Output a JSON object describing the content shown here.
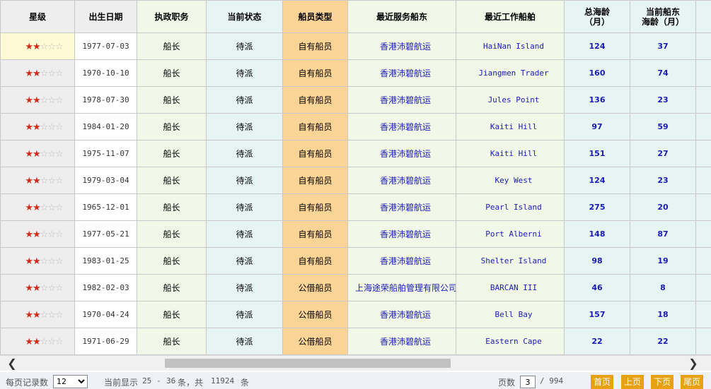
{
  "columns": {
    "star": "星级",
    "birth": "出生日期",
    "duty": "执政职务",
    "state": "当前状态",
    "type": "船员类型",
    "owner": "最近服务船东",
    "ship": "最近工作船舶",
    "total_l1": "总海龄",
    "total_l2": "（月）",
    "cur_l1": "当前船东",
    "cur_l2": "海龄（月）",
    "extra": "当"
  },
  "stars": {
    "filled": "★★",
    "empty": "☆☆☆",
    "count": 2,
    "max": 5
  },
  "rows": [
    {
      "birth": "1977-07-03",
      "duty": "船长",
      "state": "待派",
      "type": "自有船员",
      "owner": "香港沛碧航运",
      "ship": "HaiNan Island",
      "total": "124",
      "current": "37"
    },
    {
      "birth": "1970-10-10",
      "duty": "船长",
      "state": "待派",
      "type": "自有船员",
      "owner": "香港沛碧航运",
      "ship": "Jiangmen Trader",
      "total": "160",
      "current": "74"
    },
    {
      "birth": "1978-07-30",
      "duty": "船长",
      "state": "待派",
      "type": "自有船员",
      "owner": "香港沛碧航运",
      "ship": "Jules Point",
      "total": "136",
      "current": "23"
    },
    {
      "birth": "1984-01-20",
      "duty": "船长",
      "state": "待派",
      "type": "自有船员",
      "owner": "香港沛碧航运",
      "ship": "Kaiti Hill",
      "total": "97",
      "current": "59"
    },
    {
      "birth": "1975-11-07",
      "duty": "船长",
      "state": "待派",
      "type": "自有船员",
      "owner": "香港沛碧航运",
      "ship": "Kaiti Hill",
      "total": "151",
      "current": "27"
    },
    {
      "birth": "1979-03-04",
      "duty": "船长",
      "state": "待派",
      "type": "自有船员",
      "owner": "香港沛碧航运",
      "ship": "Key West",
      "total": "124",
      "current": "23"
    },
    {
      "birth": "1965-12-01",
      "duty": "船长",
      "state": "待派",
      "type": "自有船员",
      "owner": "香港沛碧航运",
      "ship": "Pearl Island",
      "total": "275",
      "current": "20"
    },
    {
      "birth": "1977-05-21",
      "duty": "船长",
      "state": "待派",
      "type": "自有船员",
      "owner": "香港沛碧航运",
      "ship": "Port Alberni",
      "total": "148",
      "current": "87"
    },
    {
      "birth": "1983-01-25",
      "duty": "船长",
      "state": "待派",
      "type": "自有船员",
      "owner": "香港沛碧航运",
      "ship": "Shelter Island",
      "total": "98",
      "current": "19"
    },
    {
      "birth": "1982-02-03",
      "duty": "船长",
      "state": "待派",
      "type": "公借船员",
      "owner": "上海途荣船舶管理有限公司",
      "ship": "BARCAN III",
      "total": "46",
      "current": "8"
    },
    {
      "birth": "1970-04-24",
      "duty": "船长",
      "state": "待派",
      "type": "公借船员",
      "owner": "香港沛碧航运",
      "ship": "Bell Bay",
      "total": "157",
      "current": "18"
    },
    {
      "birth": "1971-06-29",
      "duty": "船长",
      "state": "待派",
      "type": "公借船员",
      "owner": "香港沛碧航运",
      "ship": "Eastern Cape",
      "total": "22",
      "current": "22"
    }
  ],
  "scrollbar": {
    "left_arrow": "❮",
    "right_arrow": "❯"
  },
  "pager": {
    "per_page_label": "每页记录数",
    "per_page_value": "12",
    "showing_label": "当前显示",
    "range_from": "25",
    "range_sep": "-",
    "range_to": "36",
    "total_prefix": "条，共",
    "total": "11924",
    "total_suffix": "条",
    "page_label": "页数",
    "page_value": "3",
    "page_total": "/ 994",
    "first": "首页",
    "prev": "上页",
    "next": "下页",
    "last": "尾页"
  }
}
